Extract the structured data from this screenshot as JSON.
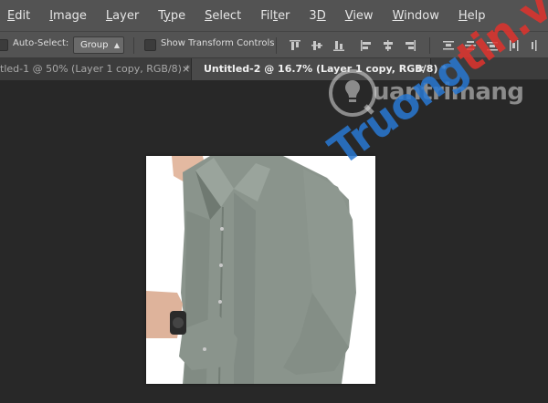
{
  "menubar": {
    "items": [
      {
        "label": "Edit",
        "ul": "E",
        "rest": "dit"
      },
      {
        "label": "Image",
        "ul": "I",
        "rest": "mage"
      },
      {
        "label": "Layer",
        "ul": "L",
        "rest": "ayer"
      },
      {
        "label": "Type",
        "ul": "Y",
        "rest": "ype"
      },
      {
        "label": "Select",
        "ul": "S",
        "rest": "elect"
      },
      {
        "label": "Filter",
        "ul": "T",
        "rest": "ilter"
      },
      {
        "label": "3D",
        "ul": "D",
        "rest": "3"
      },
      {
        "label": "View",
        "ul": "V",
        "rest": "iew"
      },
      {
        "label": "Window",
        "ul": "W",
        "rest": "indow"
      },
      {
        "label": "Help",
        "ul": "H",
        "rest": "elp"
      }
    ]
  },
  "options": {
    "auto_select_label": "Auto-Select:",
    "group_value": "Group",
    "transform_label": "Show Transform Controls"
  },
  "tabs": {
    "inactive_label": "tled-1 @ 50% (Layer 1 copy, RGB/8) *",
    "active_label": "Untitled-2 @ 16.7% (Layer 1 copy, RGB/8) *",
    "close_glyph": "×"
  },
  "watermark": {
    "brand_text": "uantrimang",
    "diag_blue": "Truong",
    "diag_red": "tin.vn"
  },
  "colors": {
    "menubar_bg": "#535353",
    "workspace_bg": "#282828",
    "shirt": "#8a948c"
  }
}
